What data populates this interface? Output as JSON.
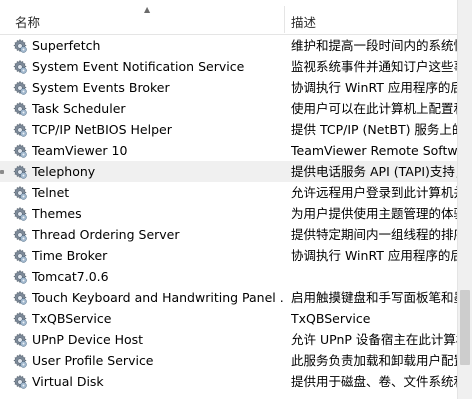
{
  "header": {
    "name_label": "名称",
    "desc_label": "描述",
    "sort_icon": "sort-ascending-icon"
  },
  "services": [
    {
      "name": "Superfetch",
      "desc": "维护和提高一段时间内的系统性"
    },
    {
      "name": "System Event Notification Service",
      "desc": "监视系统事件并通知订户这些事"
    },
    {
      "name": "System Events Broker",
      "desc": "协调执行 WinRT 应用程序的后"
    },
    {
      "name": "Task Scheduler",
      "desc": "使用户可以在此计算机上配置和"
    },
    {
      "name": "TCP/IP NetBIOS Helper",
      "desc": "提供 TCP/IP (NetBT) 服务上的"
    },
    {
      "name": "TeamViewer 10",
      "desc": "TeamViewer Remote Softwar"
    },
    {
      "name": "Telephony",
      "desc": "提供电话服务 API (TAPI)支持，"
    },
    {
      "name": "Telnet",
      "desc": "允许远程用户登录到此计算机并"
    },
    {
      "name": "Themes",
      "desc": "为用户提供使用主题管理的体验"
    },
    {
      "name": "Thread Ordering Server",
      "desc": "提供特定期间内一组线程的排序"
    },
    {
      "name": "Time Broker",
      "desc": "协调执行 WinRT 应用程序的后"
    },
    {
      "name": "Tomcat7.0.6",
      "desc": ""
    },
    {
      "name": "Touch Keyboard and Handwriting Panel ...",
      "desc": "启用触摸键盘和手写面板笔和墨"
    },
    {
      "name": "TxQBService",
      "desc": "TxQBService"
    },
    {
      "name": "UPnP Device Host",
      "desc": "允许 UPnP 设备宿主在此计算机"
    },
    {
      "name": "User Profile Service",
      "desc": "此服务负责加载和卸载用户配置"
    },
    {
      "name": "Virtual Disk",
      "desc": "提供用于磁盘、卷、文件系统和"
    }
  ],
  "selected_index": 6,
  "icons": {
    "service": "gear-service-icon"
  }
}
